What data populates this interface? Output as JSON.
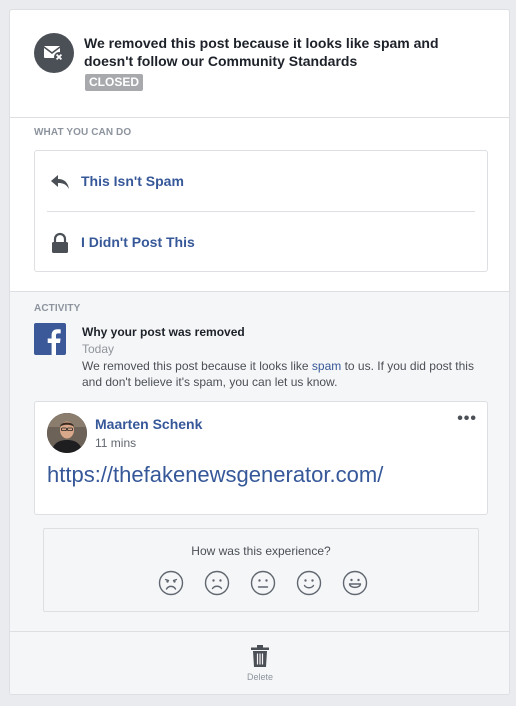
{
  "header": {
    "title": "We removed this post because it looks like spam and doesn't follow our Community Standards",
    "badge": "CLOSED",
    "icon": "envelope-x-icon"
  },
  "what_you_can_do": {
    "label": "WHAT YOU CAN DO",
    "actions": [
      {
        "label": "This Isn't Spam",
        "icon": "reply-arrow-icon"
      },
      {
        "label": "I Didn't Post This",
        "icon": "lock-icon"
      }
    ]
  },
  "activity": {
    "label": "ACTIVITY",
    "notice": {
      "title": "Why your post was removed",
      "date": "Today",
      "text_before": "We removed this post because it looks like ",
      "link": "spam",
      "text_after": " to us. If you did post this and don't believe it's spam, you can let us know."
    },
    "post": {
      "author": "Maarten Schenk",
      "time": "11 mins",
      "more": "•••",
      "link": "https://thefakenewsgenerator.com/"
    },
    "feedback": {
      "question": "How was this experience?",
      "options": [
        "very-sad-face-icon",
        "sad-face-icon",
        "neutral-face-icon",
        "smile-face-icon",
        "happy-face-icon"
      ]
    }
  },
  "footer": {
    "delete_label": "Delete"
  },
  "colors": {
    "link": "#365899",
    "facebook": "#3b5998",
    "muted": "#8d949e"
  }
}
